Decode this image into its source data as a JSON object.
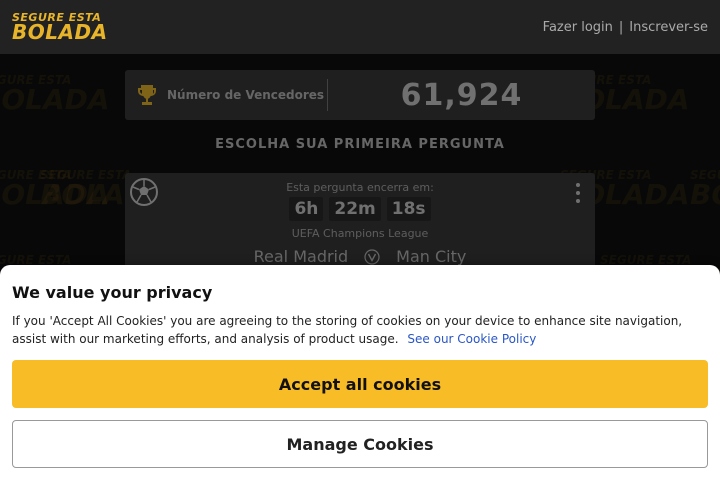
{
  "header": {
    "logo_line1": "SEGURE ESTA",
    "logo_line2": "BOLADA",
    "login_label": "Fazer login",
    "separator": "|",
    "signup_label": "Inscrever-se"
  },
  "winners": {
    "label": "Número de Vencedores",
    "count": "61,924"
  },
  "choose_label": "ESCOLHA SUA PRIMEIRA PERGUNTA",
  "question": {
    "closes_label": "Esta pergunta encerra em:",
    "timer": {
      "hours": "6h",
      "minutes": "22m",
      "seconds": "18s"
    },
    "league": "UEFA Champions League",
    "home_team": "Real Madrid",
    "away_team": "Man City",
    "sport_icon": "soccer-ball-icon",
    "vs_icon": "versus-icon"
  },
  "cookie": {
    "title": "We value your privacy",
    "text": "If you 'Accept All Cookies' you are agreeing to the storing of cookies on your device to enhance site navigation, assist with our marketing efforts, and analysis of product usage.",
    "policy_link": "See our Cookie Policy",
    "accept_label": "Accept all cookies",
    "manage_label": "Manage Cookies"
  },
  "colors": {
    "brand": "#e8b52a",
    "accept_button": "#f8bc26",
    "link": "#2a56c6"
  }
}
